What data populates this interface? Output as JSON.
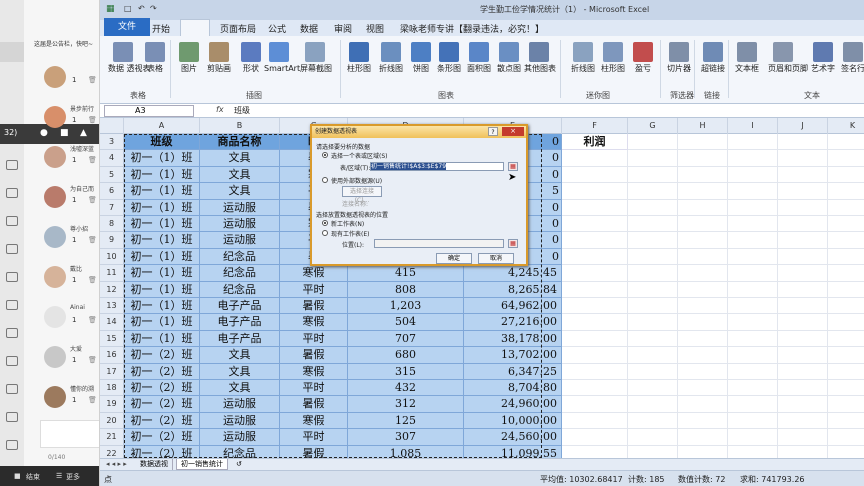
{
  "window": {
    "title": "学生勤工俭学情况统计（1） - Microsoft Excel"
  },
  "ribbon": {
    "tabs": [
      "文件",
      "开始",
      "插入",
      "页面布局",
      "公式",
      "数据",
      "审阅",
      "视图",
      "梁咏老师专讲【翻录违法，必究！】"
    ],
    "active_tab": "插入",
    "buttons": [
      {
        "label": "数据\n透视表",
        "icon": "pivot-table-icon"
      },
      {
        "label": "表格",
        "icon": "table-icon"
      },
      {
        "label": "图片",
        "icon": "picture-icon"
      },
      {
        "label": "剪贴画",
        "icon": "clipart-icon"
      },
      {
        "label": "形状",
        "icon": "shapes-icon"
      },
      {
        "label": "SmartArt",
        "icon": "smartart-icon"
      },
      {
        "label": "屏幕截图",
        "icon": "screenshot-icon"
      },
      {
        "label": "柱形图",
        "icon": "column-chart-icon"
      },
      {
        "label": "折线图",
        "icon": "line-chart-icon"
      },
      {
        "label": "饼图",
        "icon": "pie-chart-icon"
      },
      {
        "label": "条形图",
        "icon": "bar-chart-icon"
      },
      {
        "label": "面积图",
        "icon": "area-chart-icon"
      },
      {
        "label": "散点图",
        "icon": "scatter-chart-icon"
      },
      {
        "label": "其他图表",
        "icon": "other-chart-icon"
      },
      {
        "label": "折线图",
        "icon": "sparkline-line-icon"
      },
      {
        "label": "柱形图",
        "icon": "sparkline-column-icon"
      },
      {
        "label": "盈亏",
        "icon": "winloss-icon"
      },
      {
        "label": "切片器",
        "icon": "slicer-icon"
      },
      {
        "label": "超链接",
        "icon": "hyperlink-icon"
      },
      {
        "label": "文本框",
        "icon": "textbox-icon"
      },
      {
        "label": "页眉和页脚",
        "icon": "header-footer-icon"
      },
      {
        "label": "艺术字",
        "icon": "wordart-icon"
      },
      {
        "label": "签名行",
        "icon": "signature-icon"
      }
    ],
    "groups": [
      "表格",
      "插图",
      "图表",
      "迷你图",
      "筛选器",
      "链接",
      "文本"
    ]
  },
  "formula_bar": {
    "name_box": "A3",
    "fx": "fx",
    "value": "班级"
  },
  "columns": [
    "A",
    "B",
    "C",
    "D",
    "E",
    "F",
    "G",
    "H",
    "I",
    "J",
    "K"
  ],
  "header_row": {
    "row": "3",
    "class": "班级",
    "product": "商品名称",
    "period": "时",
    "f": "利润"
  },
  "rows": [
    {
      "row": "4",
      "class": "初一（1）班",
      "product": "文具",
      "period": "暑",
      "qty": "",
      "amount": ""
    },
    {
      "row": "5",
      "class": "初一（1）班",
      "product": "文具",
      "period": "寒",
      "qty": "",
      "amount": ""
    },
    {
      "row": "6",
      "class": "初一（1）班",
      "product": "文具",
      "period": "平",
      "qty": "",
      "amount": ""
    },
    {
      "row": "7",
      "class": "初一（1）班",
      "product": "运动服",
      "period": "暑",
      "qty": "",
      "amount": ""
    },
    {
      "row": "8",
      "class": "初一（1）班",
      "product": "运动服",
      "period": "寒",
      "qty": "",
      "amount": ""
    },
    {
      "row": "9",
      "class": "初一（1）班",
      "product": "运动服",
      "period": "平",
      "qty": "",
      "amount": ""
    },
    {
      "row": "10",
      "class": "初一（1）班",
      "product": "纪念品",
      "period": "暑",
      "qty": "",
      "amount": ""
    },
    {
      "row": "11",
      "class": "初一（1）班",
      "product": "纪念品",
      "period": "寒假",
      "qty": "415",
      "amount": "4,245.45"
    },
    {
      "row": "12",
      "class": "初一（1）班",
      "product": "纪念品",
      "period": "平时",
      "qty": "808",
      "amount": "8,265.84"
    },
    {
      "row": "13",
      "class": "初一（1）班",
      "product": "电子产品",
      "period": "暑假",
      "qty": "1,203",
      "amount": "64,962.00"
    },
    {
      "row": "14",
      "class": "初一（1）班",
      "product": "电子产品",
      "period": "寒假",
      "qty": "504",
      "amount": "27,216.00"
    },
    {
      "row": "15",
      "class": "初一（1）班",
      "product": "电子产品",
      "period": "平时",
      "qty": "707",
      "amount": "38,178.00"
    },
    {
      "row": "16",
      "class": "初一（2）班",
      "product": "文具",
      "period": "暑假",
      "qty": "680",
      "amount": "13,702.00"
    },
    {
      "row": "17",
      "class": "初一（2）班",
      "product": "文具",
      "period": "寒假",
      "qty": "315",
      "amount": "6,347.25"
    },
    {
      "row": "18",
      "class": "初一（2）班",
      "product": "文具",
      "period": "平时",
      "qty": "432",
      "amount": "8,704.80"
    },
    {
      "row": "19",
      "class": "初一（2）班",
      "product": "运动服",
      "period": "暑假",
      "qty": "312",
      "amount": "24,960.00"
    },
    {
      "row": "20",
      "class": "初一（2）班",
      "product": "运动服",
      "period": "寒假",
      "qty": "125",
      "amount": "10,000.00"
    },
    {
      "row": "21",
      "class": "初一（2）班",
      "product": "运动服",
      "period": "平时",
      "qty": "307",
      "amount": "24,560.00"
    },
    {
      "row": "22",
      "class": "初一（2）班",
      "product": "纪念品",
      "period": "暑假",
      "qty": "1,085",
      "amount": "11,099.55"
    }
  ],
  "partial_e_values": [
    {
      "row": "3",
      "text": "0"
    },
    {
      "row": "4",
      "text": "0"
    },
    {
      "row": "5",
      "text": "0"
    },
    {
      "row": "6",
      "text": "5"
    },
    {
      "row": "7",
      "text": "0"
    },
    {
      "row": "8",
      "text": "0"
    },
    {
      "row": "9",
      "text": "0"
    },
    {
      "row": "10",
      "text": "0"
    }
  ],
  "dialog": {
    "title": "创建数据透视表",
    "help": "?",
    "close": "×",
    "section1": "请选择要分析的数据",
    "opt_select_range": "选择一个表或区域(S)",
    "range_label": "表/区域(T):",
    "range_value": "初一销售统计!$A$3:$E$79",
    "opt_external": "使用外部数据源(U)",
    "choose_conn": "选择连接(C)...",
    "conn_name": "连接名称:",
    "section2": "选择放置数据透视表的位置",
    "opt_new_sheet": "新工作表(N)",
    "opt_existing": "现有工作表(E)",
    "location_label": "位置(L):",
    "ok": "确定",
    "cancel": "取消"
  },
  "sheet_tabs": {
    "nav": "◂ ◂ ▸ ▸",
    "tabs": [
      "数据透视",
      "初一销售统计"
    ],
    "active": "初一销售统计"
  },
  "status": {
    "mode": "点",
    "average": "平均值: 10302.68417",
    "count": "计数: 185",
    "numcount": "数值计数: 72",
    "sum": "求和: 741793.26"
  },
  "chat": {
    "notice": "这届是公告栏，快吧~",
    "items": [
      {
        "name": "",
        "count": "1"
      },
      {
        "name": "景步前行",
        "count": "1"
      },
      {
        "name": "浅嘘深蓝",
        "count": "1"
      },
      {
        "name": "为自己而",
        "count": "1"
      },
      {
        "name": "尊小招",
        "count": "1"
      },
      {
        "name": "戴比",
        "count": "1"
      },
      {
        "name": "Ainai",
        "count": "1"
      },
      {
        "name": "大爱",
        "count": "1"
      },
      {
        "name": "懂你的溯",
        "count": "1"
      }
    ],
    "left_label": "32)",
    "counter": "0/140",
    "end_label": "结束",
    "more_label": "更多"
  }
}
